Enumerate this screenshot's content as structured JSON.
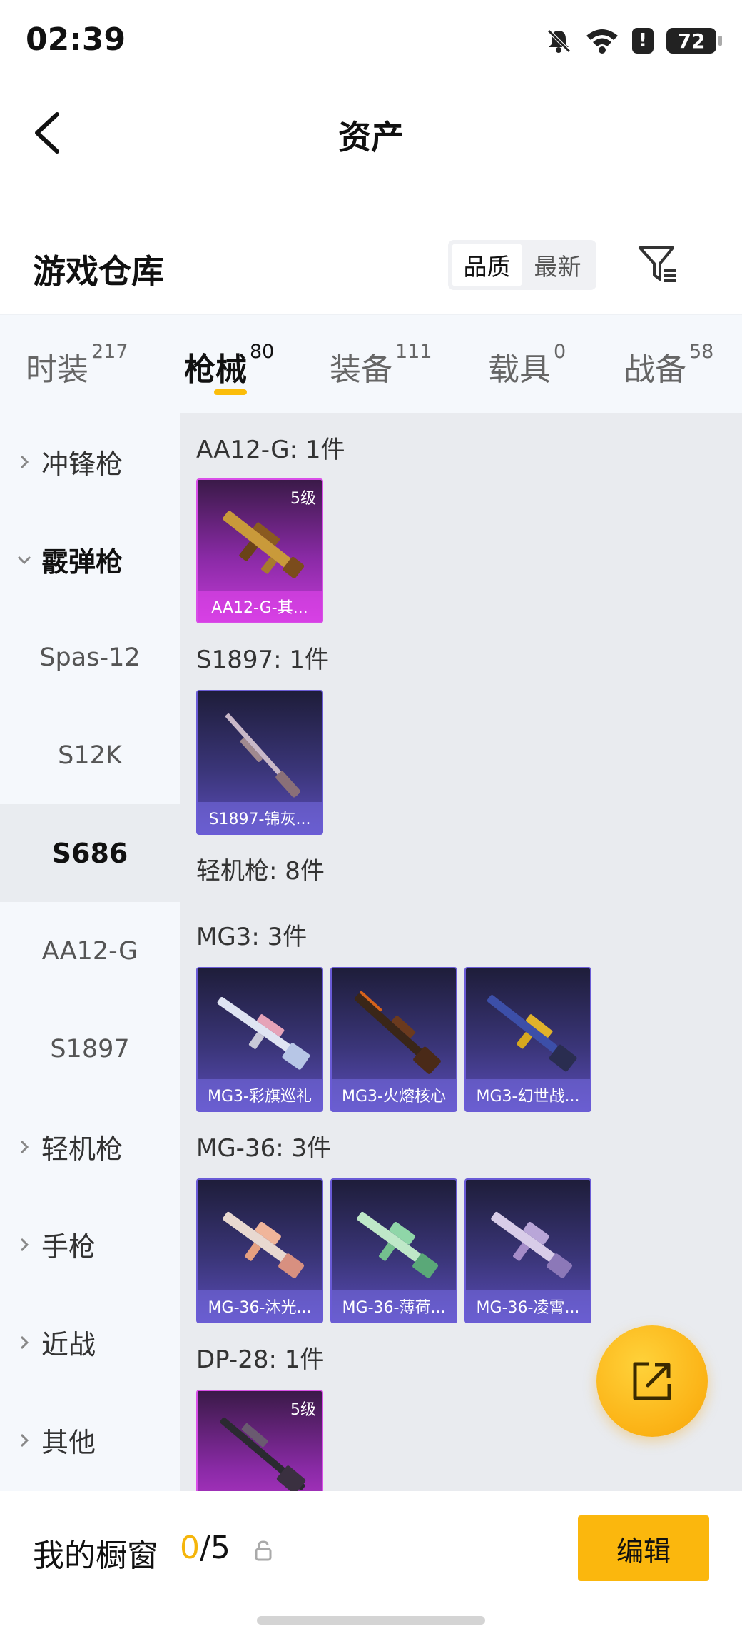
{
  "status": {
    "time": "02:39",
    "battery": "72"
  },
  "nav": {
    "title": "资产"
  },
  "warehouse": {
    "title": "游戏仓库",
    "sort_quality": "品质",
    "sort_latest": "最新"
  },
  "tabs": [
    {
      "label": "时装",
      "count": "217"
    },
    {
      "label": "枪械",
      "count": "80"
    },
    {
      "label": "装备",
      "count": "111"
    },
    {
      "label": "载具",
      "count": "0"
    },
    {
      "label": "战备",
      "count": "58"
    }
  ],
  "sidebar": {
    "items": [
      {
        "label": "冲锋枪"
      },
      {
        "label": "霰弹枪"
      },
      {
        "label": "Spas-12"
      },
      {
        "label": "S12K"
      },
      {
        "label": "S686"
      },
      {
        "label": "AA12-G"
      },
      {
        "label": "S1897"
      },
      {
        "label": "轻机枪"
      },
      {
        "label": "手枪"
      },
      {
        "label": "近战"
      },
      {
        "label": "其他"
      }
    ]
  },
  "content": {
    "groups": [
      {
        "title": "AA12-G: 1件",
        "items": [
          {
            "name": "AA12-G-其...",
            "level": "5级",
            "rarity": "gold"
          }
        ]
      },
      {
        "title": "S1897: 1件",
        "items": [
          {
            "name": "S1897-锦灰...",
            "rarity": "blue"
          }
        ]
      },
      {
        "title": "轻机枪: 8件"
      },
      {
        "title": "MG3: 3件",
        "items": [
          {
            "name": "MG3-彩旗巡礼",
            "rarity": "blue"
          },
          {
            "name": "MG3-火熔核心",
            "rarity": "blue"
          },
          {
            "name": "MG3-幻世战...",
            "rarity": "blue"
          }
        ]
      },
      {
        "title": "MG-36: 3件",
        "items": [
          {
            "name": "MG-36-沐光...",
            "rarity": "blue"
          },
          {
            "name": "MG-36-薄荷...",
            "rarity": "blue"
          },
          {
            "name": "MG-36-凌霄...",
            "rarity": "blue"
          }
        ]
      },
      {
        "title": "DP-28: 1件",
        "items": [
          {
            "level": "5级",
            "rarity": "gold"
          }
        ]
      }
    ]
  },
  "showcase": {
    "label": "我的橱窗",
    "current": "0",
    "total": "/5",
    "edit_label": "编辑"
  },
  "colors": {
    "accent": "#fbb70d",
    "gold_card": "#c33bd6",
    "blue_card": "#5a4cb8"
  }
}
